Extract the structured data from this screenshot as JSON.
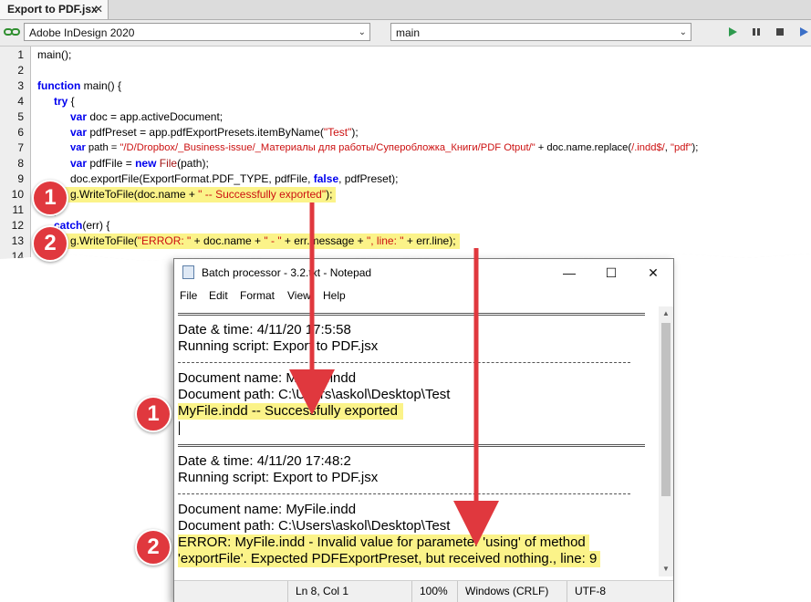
{
  "editor": {
    "tab_title": "Export to PDF.jsx",
    "tab_close": "✕",
    "target_app": "Adobe InDesign 2020",
    "function_select": "main",
    "dropdown_arrow": "⌄",
    "line_numbers": [
      "1",
      "2",
      "3",
      "4",
      "5",
      "6",
      "7",
      "8",
      "9",
      "10",
      "11",
      "12",
      "13",
      "14"
    ],
    "code": {
      "l1": "main();",
      "l3_kw": "function",
      "l3_rest": " main() {",
      "l4_kw": "try",
      "l4_rest": " {",
      "l5_kw": "var",
      "l5_rest": " doc = app.activeDocument;",
      "l6_kw": "var",
      "l6_a": " pdfPreset = app.pdfExportPresets.itemByName(",
      "l6_str": "\"Test\"",
      "l6_b": ");",
      "l7_kw": "var",
      "l7_a": " path = ",
      "l7_str": "\"/D/Dropbox/_Business-issue/_Материалы для работы/Супероблoжка_Книги/PDF Otput/\"",
      "l7_b": " + doc.name.replace(",
      "l7_re": "/.indd$/",
      "l7_c": ", ",
      "l7_str2": "\"pdf\"",
      "l7_d": ");",
      "l8_kw": "var",
      "l8_a": " pdfFile = ",
      "l8_kw2": "new",
      "l8_b": " ",
      "l8_fn": "File",
      "l8_c": "(path);",
      "l9_a": "doc.exportFile(ExportFormat.PDF_TYPE, pdfFile, ",
      "l9_kw": "false",
      "l9_b": ", pdfPreset);",
      "l10_a": "g.WriteToFile(doc.name + ",
      "l10_str": "\" -- Successfully exported\"",
      "l10_b": ");",
      "l11": "}",
      "l12_kw": "catch",
      "l12_rest": "(err) {",
      "l13_a": "g.WriteToFile(",
      "l13_s1": "\"ERROR: \"",
      "l13_b": " + doc.name + ",
      "l13_s2": "\" - \"",
      "l13_c": " + err.message + ",
      "l13_s3": "\", line: \"",
      "l13_d": " + err.line);"
    }
  },
  "notepad": {
    "title": "Batch processor - 3.2.txt - Notepad",
    "menu": [
      "File",
      "Edit",
      "Format",
      "View",
      "Help"
    ],
    "window_controls": {
      "minimize": "—",
      "maximize": "☐",
      "close": "✕"
    },
    "lines": {
      "date1": "Date & time: 4/11/20 17:5:58",
      "script1": "Running script: Export to PDF.jsx",
      "docname1": "Document name: MyFile.indd",
      "docpath1": "Document path: C:\\Users\\askol\\Desktop\\Test",
      "success": "MyFile.indd -- Successfully exported",
      "date2": "Date & time: 4/11/20 17:48:2",
      "script2": "Running script: Export to PDF.jsx",
      "docname2": "Document name: MyFile.indd",
      "docpath2": "Document path: C:\\Users\\askol\\Desktop\\Test",
      "error1": "ERROR: MyFile.indd - Invalid value for parameter 'using' of method",
      "error2": "'exportFile'. Expected PDFExportPreset, but received nothing., line: 9"
    },
    "status": {
      "position": "Ln 8, Col 1",
      "zoom": "100%",
      "line_ending": "Windows (CRLF)",
      "encoding": "UTF-8"
    }
  },
  "annotations": {
    "badge1": "1",
    "badge2": "2",
    "color": "#e0383e",
    "highlight": "#fbf389"
  }
}
